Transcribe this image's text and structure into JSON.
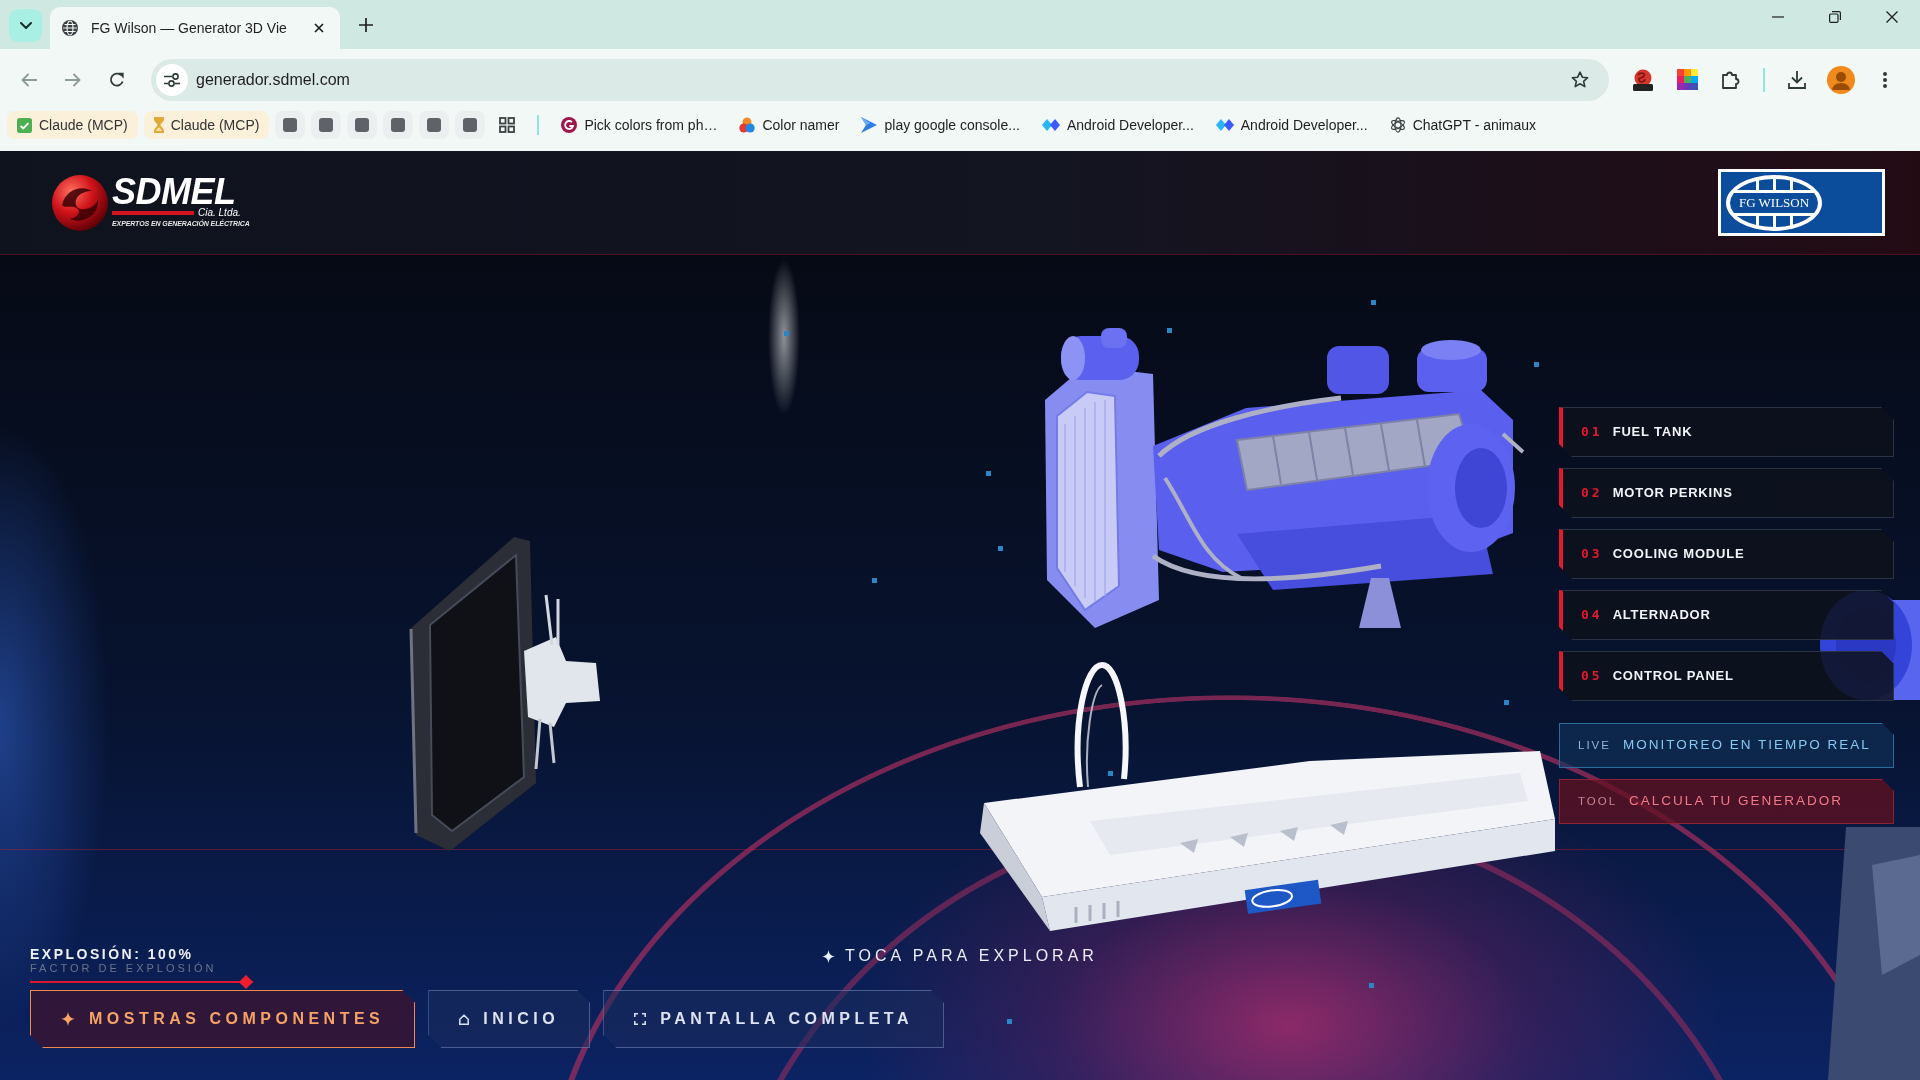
{
  "browser": {
    "tab": {
      "title": "FG Wilson — Generator 3D Vie"
    },
    "address": "generador.sdmel.com",
    "bookmarks": [
      {
        "label": "Claude (MCP)",
        "kind": "check"
      },
      {
        "label": "Claude (MCP)",
        "kind": "hourglass"
      },
      {
        "kind": "square"
      },
      {
        "kind": "square"
      },
      {
        "kind": "square"
      },
      {
        "kind": "square"
      },
      {
        "kind": "square"
      },
      {
        "kind": "square"
      },
      {
        "kind": "apps"
      },
      {
        "label": "Pick colors from ph…",
        "kind": "circle"
      },
      {
        "label": "Color namer",
        "kind": "dots"
      },
      {
        "label": "play google console...",
        "kind": "arrow"
      },
      {
        "label": "Android Developer...",
        "kind": "diamonds"
      },
      {
        "label": "Android Developer...",
        "kind": "diamonds"
      },
      {
        "label": "ChatGPT - animaux",
        "kind": "knot"
      }
    ]
  },
  "header": {
    "brand": {
      "name": "SDMEL",
      "suffix": "Cia. Ltda.",
      "tagline": "EXPERTOS EN GENERACIÓN ELÉCTRICA"
    },
    "partner": {
      "name": "FG WILSON"
    }
  },
  "components": [
    {
      "number": "01",
      "label": "FUEL TANK"
    },
    {
      "number": "02",
      "label": "MOTOR PERKINS"
    },
    {
      "number": "03",
      "label": "COOLING MODULE"
    },
    {
      "number": "04",
      "label": "ALTERNADOR"
    },
    {
      "number": "05",
      "label": "CONTROL PANEL"
    }
  ],
  "links": [
    {
      "tag": "LIVE",
      "label": "MONITOREO EN TIEMPO REAL",
      "kind": "live"
    },
    {
      "tag": "TOOL",
      "label": "CALCULA TU GENERADOR",
      "kind": "tool"
    }
  ],
  "explosion": {
    "label": "EXPLOSIÓN: 100%",
    "caption": "FACTOR DE EXPLOSIÓN",
    "level": 1
  },
  "hint": "TOCA PARA EXPLORAR",
  "actions": [
    {
      "label": "MOSTRAS COMPONENTES",
      "kind": "components",
      "active": true
    },
    {
      "label": "INICIO",
      "kind": "home",
      "active": false
    },
    {
      "label": "PANTALLA COMPLETA",
      "kind": "fullscreen",
      "active": false
    }
  ]
}
